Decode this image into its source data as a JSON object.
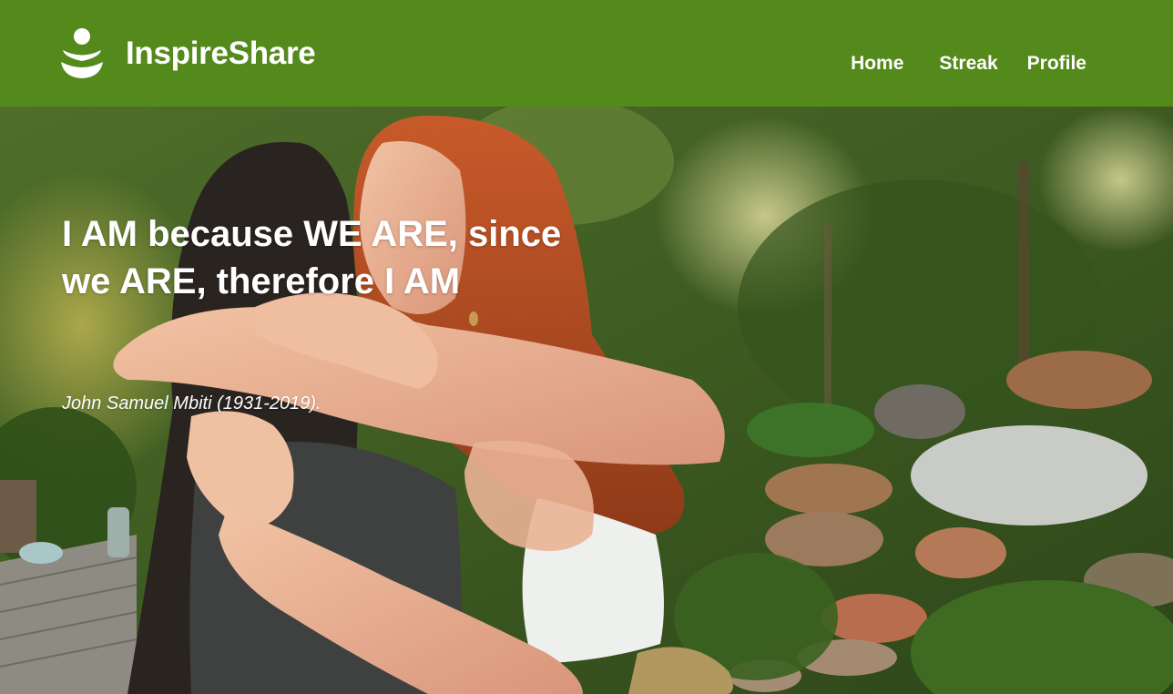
{
  "app": {
    "name": "InspireShare"
  },
  "nav": {
    "items": [
      {
        "label": "Home"
      },
      {
        "label": "Streak"
      },
      {
        "label": "Profile"
      }
    ]
  },
  "hero": {
    "quote": "I AM because WE ARE, since we ARE, therefore I AM",
    "author": "John Samuel Mbiti (1931-2019)."
  },
  "colors": {
    "brand": "#548a1b",
    "text": "#ffffff"
  },
  "icons": {
    "logo": "person-waves-logo-icon"
  }
}
